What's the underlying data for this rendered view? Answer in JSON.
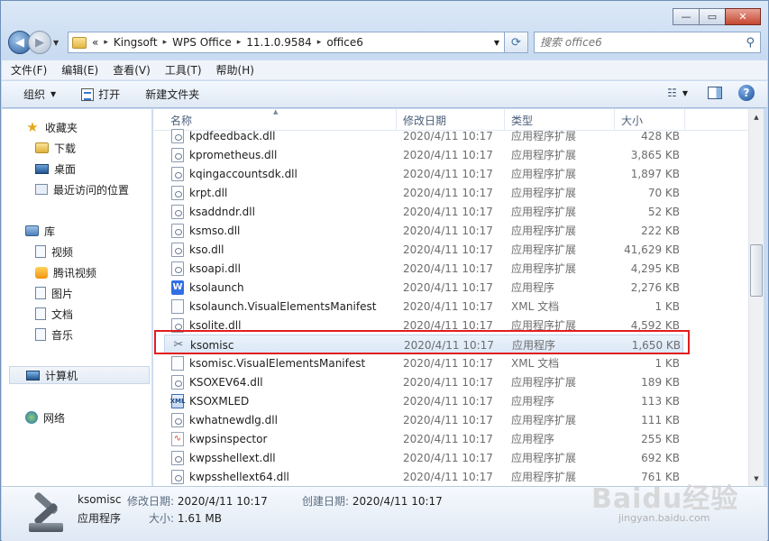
{
  "window": {
    "caption_min": "—",
    "caption_max": "▭",
    "caption_close": "✕"
  },
  "address": {
    "overflow": "«",
    "crumbs": [
      "Kingsoft",
      "WPS Office",
      "11.1.0.9584",
      "office6"
    ],
    "separator": "▸"
  },
  "search": {
    "placeholder": "搜索 office6"
  },
  "menu": [
    "文件(F)",
    "编辑(E)",
    "查看(V)",
    "工具(T)",
    "帮助(H)"
  ],
  "toolbar": {
    "organize": "组织",
    "open": "打开",
    "new_folder": "新建文件夹"
  },
  "nav": {
    "favorites": "收藏夹",
    "downloads": "下载",
    "desktop": "桌面",
    "recent": "最近访问的位置",
    "libraries": "库",
    "videos": "视频",
    "tencent_video": "腾讯视频",
    "pictures": "图片",
    "documents": "文档",
    "music": "音乐",
    "computer": "计算机",
    "network": "网络"
  },
  "columns": {
    "name": "名称",
    "date": "修改日期",
    "type": "类型",
    "size": "大小"
  },
  "files": [
    {
      "name": "kpdfeedback.dll",
      "date": "2020/4/11 10:17",
      "type": "应用程序扩展",
      "size": "428 KB",
      "icon": "dll"
    },
    {
      "name": "kprometheus.dll",
      "date": "2020/4/11 10:17",
      "type": "应用程序扩展",
      "size": "3,865 KB",
      "icon": "dll"
    },
    {
      "name": "kqingaccountsdk.dll",
      "date": "2020/4/11 10:17",
      "type": "应用程序扩展",
      "size": "1,897 KB",
      "icon": "dll"
    },
    {
      "name": "krpt.dll",
      "date": "2020/4/11 10:17",
      "type": "应用程序扩展",
      "size": "70 KB",
      "icon": "dll"
    },
    {
      "name": "ksaddndr.dll",
      "date": "2020/4/11 10:17",
      "type": "应用程序扩展",
      "size": "52 KB",
      "icon": "dll"
    },
    {
      "name": "ksmso.dll",
      "date": "2020/4/11 10:17",
      "type": "应用程序扩展",
      "size": "222 KB",
      "icon": "dll"
    },
    {
      "name": "kso.dll",
      "date": "2020/4/11 10:17",
      "type": "应用程序扩展",
      "size": "41,629 KB",
      "icon": "dll"
    },
    {
      "name": "ksoapi.dll",
      "date": "2020/4/11 10:17",
      "type": "应用程序扩展",
      "size": "4,295 KB",
      "icon": "dll"
    },
    {
      "name": "ksolaunch",
      "date": "2020/4/11 10:17",
      "type": "应用程序",
      "size": "2,276 KB",
      "icon": "wps"
    },
    {
      "name": "ksolaunch.VisualElementsManifest",
      "date": "2020/4/11 10:17",
      "type": "XML 文档",
      "size": "1 KB",
      "icon": "generic"
    },
    {
      "name": "ksolite.dll",
      "date": "2020/4/11 10:17",
      "type": "应用程序扩展",
      "size": "4,592 KB",
      "icon": "dll"
    },
    {
      "name": "ksomisc",
      "date": "2020/4/11 10:17",
      "type": "应用程序",
      "size": "1,650 KB",
      "icon": "tools"
    },
    {
      "name": "ksomisc.VisualElementsManifest",
      "date": "2020/4/11 10:17",
      "type": "XML 文档",
      "size": "1 KB",
      "icon": "generic"
    },
    {
      "name": "KSOXEV64.dll",
      "date": "2020/4/11 10:17",
      "type": "应用程序扩展",
      "size": "189 KB",
      "icon": "dll"
    },
    {
      "name": "KSOXMLED",
      "date": "2020/4/11 10:17",
      "type": "应用程序",
      "size": "113 KB",
      "icon": "xml-app"
    },
    {
      "name": "kwhatnewdlg.dll",
      "date": "2020/4/11 10:17",
      "type": "应用程序扩展",
      "size": "111 KB",
      "icon": "dll"
    },
    {
      "name": "kwpsinspector",
      "date": "2020/4/11 10:17",
      "type": "应用程序",
      "size": "255 KB",
      "icon": "pulse"
    },
    {
      "name": "kwpsshellext.dll",
      "date": "2020/4/11 10:17",
      "type": "应用程序扩展",
      "size": "692 KB",
      "icon": "dll"
    },
    {
      "name": "kwpsshellext64.dll",
      "date": "2020/4/11 10:17",
      "type": "应用程序扩展",
      "size": "761 KB",
      "icon": "dll"
    }
  ],
  "selected_index": 11,
  "details": {
    "name": "ksomisc",
    "modified_label": "修改日期:",
    "modified": "2020/4/11 10:17",
    "created_label": "创建日期:",
    "created": "2020/4/11 10:17",
    "type": "应用程序",
    "size_label": "大小:",
    "size": "1.61 MB"
  },
  "watermark": {
    "main": "Baidu经验",
    "sub": "jingyan.baidu.com"
  },
  "colors": {
    "highlight_box": "#e21d1d",
    "selection": "#dbe8f6"
  }
}
